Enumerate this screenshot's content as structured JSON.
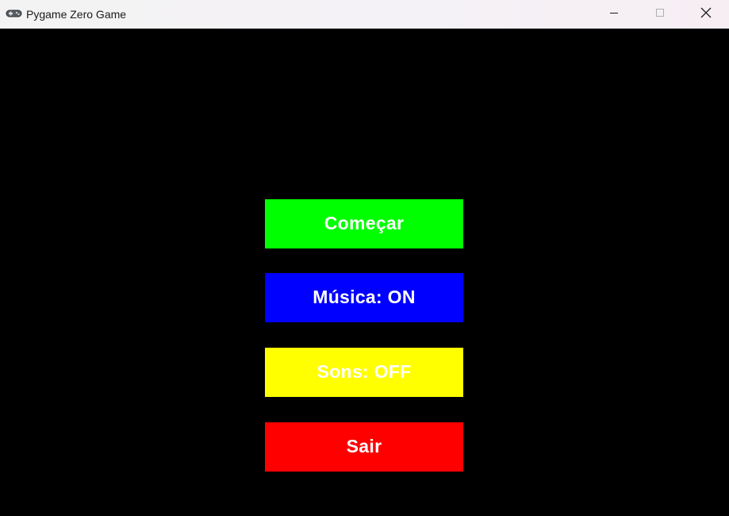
{
  "window": {
    "title": "Pygame Zero Game",
    "app_icon": "gamepad-icon",
    "controls": {
      "minimize_icon": "minimize-icon",
      "maximize_icon": "maximize-icon",
      "close_icon": "close-icon"
    }
  },
  "menu": {
    "buttons": [
      {
        "label": "Começar",
        "color": "#00ff00"
      },
      {
        "label": "Música: ON",
        "color": "#0000ff"
      },
      {
        "label": "Sons: OFF",
        "color": "#ffff00"
      },
      {
        "label": "Sair",
        "color": "#ff0000"
      }
    ],
    "text_color": "#ffffff",
    "background_color": "#000000"
  }
}
